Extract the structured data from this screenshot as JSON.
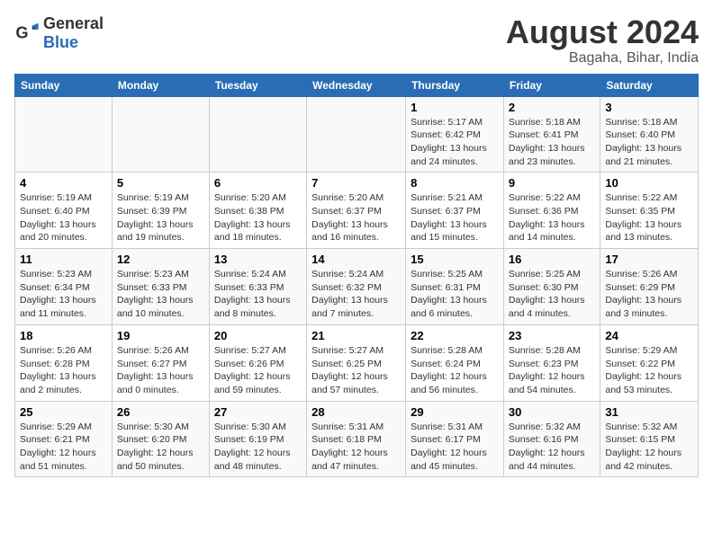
{
  "logo": {
    "general": "General",
    "blue": "Blue"
  },
  "title": "August 2024",
  "subtitle": "Bagaha, Bihar, India",
  "days_of_week": [
    "Sunday",
    "Monday",
    "Tuesday",
    "Wednesday",
    "Thursday",
    "Friday",
    "Saturday"
  ],
  "weeks": [
    [
      {
        "day": "",
        "info": ""
      },
      {
        "day": "",
        "info": ""
      },
      {
        "day": "",
        "info": ""
      },
      {
        "day": "",
        "info": ""
      },
      {
        "day": "1",
        "info": "Sunrise: 5:17 AM\nSunset: 6:42 PM\nDaylight: 13 hours and 24 minutes."
      },
      {
        "day": "2",
        "info": "Sunrise: 5:18 AM\nSunset: 6:41 PM\nDaylight: 13 hours and 23 minutes."
      },
      {
        "day": "3",
        "info": "Sunrise: 5:18 AM\nSunset: 6:40 PM\nDaylight: 13 hours and 21 minutes."
      }
    ],
    [
      {
        "day": "4",
        "info": "Sunrise: 5:19 AM\nSunset: 6:40 PM\nDaylight: 13 hours and 20 minutes."
      },
      {
        "day": "5",
        "info": "Sunrise: 5:19 AM\nSunset: 6:39 PM\nDaylight: 13 hours and 19 minutes."
      },
      {
        "day": "6",
        "info": "Sunrise: 5:20 AM\nSunset: 6:38 PM\nDaylight: 13 hours and 18 minutes."
      },
      {
        "day": "7",
        "info": "Sunrise: 5:20 AM\nSunset: 6:37 PM\nDaylight: 13 hours and 16 minutes."
      },
      {
        "day": "8",
        "info": "Sunrise: 5:21 AM\nSunset: 6:37 PM\nDaylight: 13 hours and 15 minutes."
      },
      {
        "day": "9",
        "info": "Sunrise: 5:22 AM\nSunset: 6:36 PM\nDaylight: 13 hours and 14 minutes."
      },
      {
        "day": "10",
        "info": "Sunrise: 5:22 AM\nSunset: 6:35 PM\nDaylight: 13 hours and 13 minutes."
      }
    ],
    [
      {
        "day": "11",
        "info": "Sunrise: 5:23 AM\nSunset: 6:34 PM\nDaylight: 13 hours and 11 minutes."
      },
      {
        "day": "12",
        "info": "Sunrise: 5:23 AM\nSunset: 6:33 PM\nDaylight: 13 hours and 10 minutes."
      },
      {
        "day": "13",
        "info": "Sunrise: 5:24 AM\nSunset: 6:33 PM\nDaylight: 13 hours and 8 minutes."
      },
      {
        "day": "14",
        "info": "Sunrise: 5:24 AM\nSunset: 6:32 PM\nDaylight: 13 hours and 7 minutes."
      },
      {
        "day": "15",
        "info": "Sunrise: 5:25 AM\nSunset: 6:31 PM\nDaylight: 13 hours and 6 minutes."
      },
      {
        "day": "16",
        "info": "Sunrise: 5:25 AM\nSunset: 6:30 PM\nDaylight: 13 hours and 4 minutes."
      },
      {
        "day": "17",
        "info": "Sunrise: 5:26 AM\nSunset: 6:29 PM\nDaylight: 13 hours and 3 minutes."
      }
    ],
    [
      {
        "day": "18",
        "info": "Sunrise: 5:26 AM\nSunset: 6:28 PM\nDaylight: 13 hours and 2 minutes."
      },
      {
        "day": "19",
        "info": "Sunrise: 5:26 AM\nSunset: 6:27 PM\nDaylight: 13 hours and 0 minutes."
      },
      {
        "day": "20",
        "info": "Sunrise: 5:27 AM\nSunset: 6:26 PM\nDaylight: 12 hours and 59 minutes."
      },
      {
        "day": "21",
        "info": "Sunrise: 5:27 AM\nSunset: 6:25 PM\nDaylight: 12 hours and 57 minutes."
      },
      {
        "day": "22",
        "info": "Sunrise: 5:28 AM\nSunset: 6:24 PM\nDaylight: 12 hours and 56 minutes."
      },
      {
        "day": "23",
        "info": "Sunrise: 5:28 AM\nSunset: 6:23 PM\nDaylight: 12 hours and 54 minutes."
      },
      {
        "day": "24",
        "info": "Sunrise: 5:29 AM\nSunset: 6:22 PM\nDaylight: 12 hours and 53 minutes."
      }
    ],
    [
      {
        "day": "25",
        "info": "Sunrise: 5:29 AM\nSunset: 6:21 PM\nDaylight: 12 hours and 51 minutes."
      },
      {
        "day": "26",
        "info": "Sunrise: 5:30 AM\nSunset: 6:20 PM\nDaylight: 12 hours and 50 minutes."
      },
      {
        "day": "27",
        "info": "Sunrise: 5:30 AM\nSunset: 6:19 PM\nDaylight: 12 hours and 48 minutes."
      },
      {
        "day": "28",
        "info": "Sunrise: 5:31 AM\nSunset: 6:18 PM\nDaylight: 12 hours and 47 minutes."
      },
      {
        "day": "29",
        "info": "Sunrise: 5:31 AM\nSunset: 6:17 PM\nDaylight: 12 hours and 45 minutes."
      },
      {
        "day": "30",
        "info": "Sunrise: 5:32 AM\nSunset: 6:16 PM\nDaylight: 12 hours and 44 minutes."
      },
      {
        "day": "31",
        "info": "Sunrise: 5:32 AM\nSunset: 6:15 PM\nDaylight: 12 hours and 42 minutes."
      }
    ]
  ]
}
